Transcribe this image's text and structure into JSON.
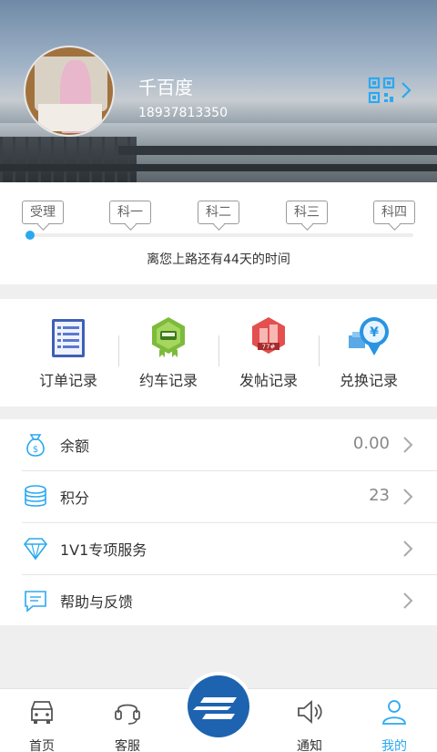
{
  "profile": {
    "name": "千百度",
    "phone": "18937813350",
    "qr_icon": "qr-code-icon"
  },
  "progress": {
    "stages": [
      "受理",
      "科一",
      "科二",
      "科三",
      "科四"
    ],
    "current_stage": 0,
    "countdown_text": "离您上路还有44天的时间",
    "accent_color": "#2aa9f0"
  },
  "records": [
    {
      "label": "订单记录",
      "icon": "order-list-icon"
    },
    {
      "label": "约车记录",
      "icon": "car-booking-icon"
    },
    {
      "label": "发帖记录",
      "icon": "post-icon"
    },
    {
      "label": "兑换记录",
      "icon": "exchange-icon"
    }
  ],
  "account": {
    "balance": {
      "label": "余额",
      "value": "0.00",
      "icon": "money-bag-icon"
    },
    "points": {
      "label": "积分",
      "value": "23",
      "icon": "coins-icon"
    },
    "vip": {
      "label": "1V1专项服务",
      "icon": "diamond-icon"
    },
    "help": {
      "label": "帮助与反馈",
      "icon": "chat-icon"
    }
  },
  "nav": {
    "home": "首页",
    "service": "客服",
    "notify": "通知",
    "mine": "我的",
    "active": "mine"
  }
}
